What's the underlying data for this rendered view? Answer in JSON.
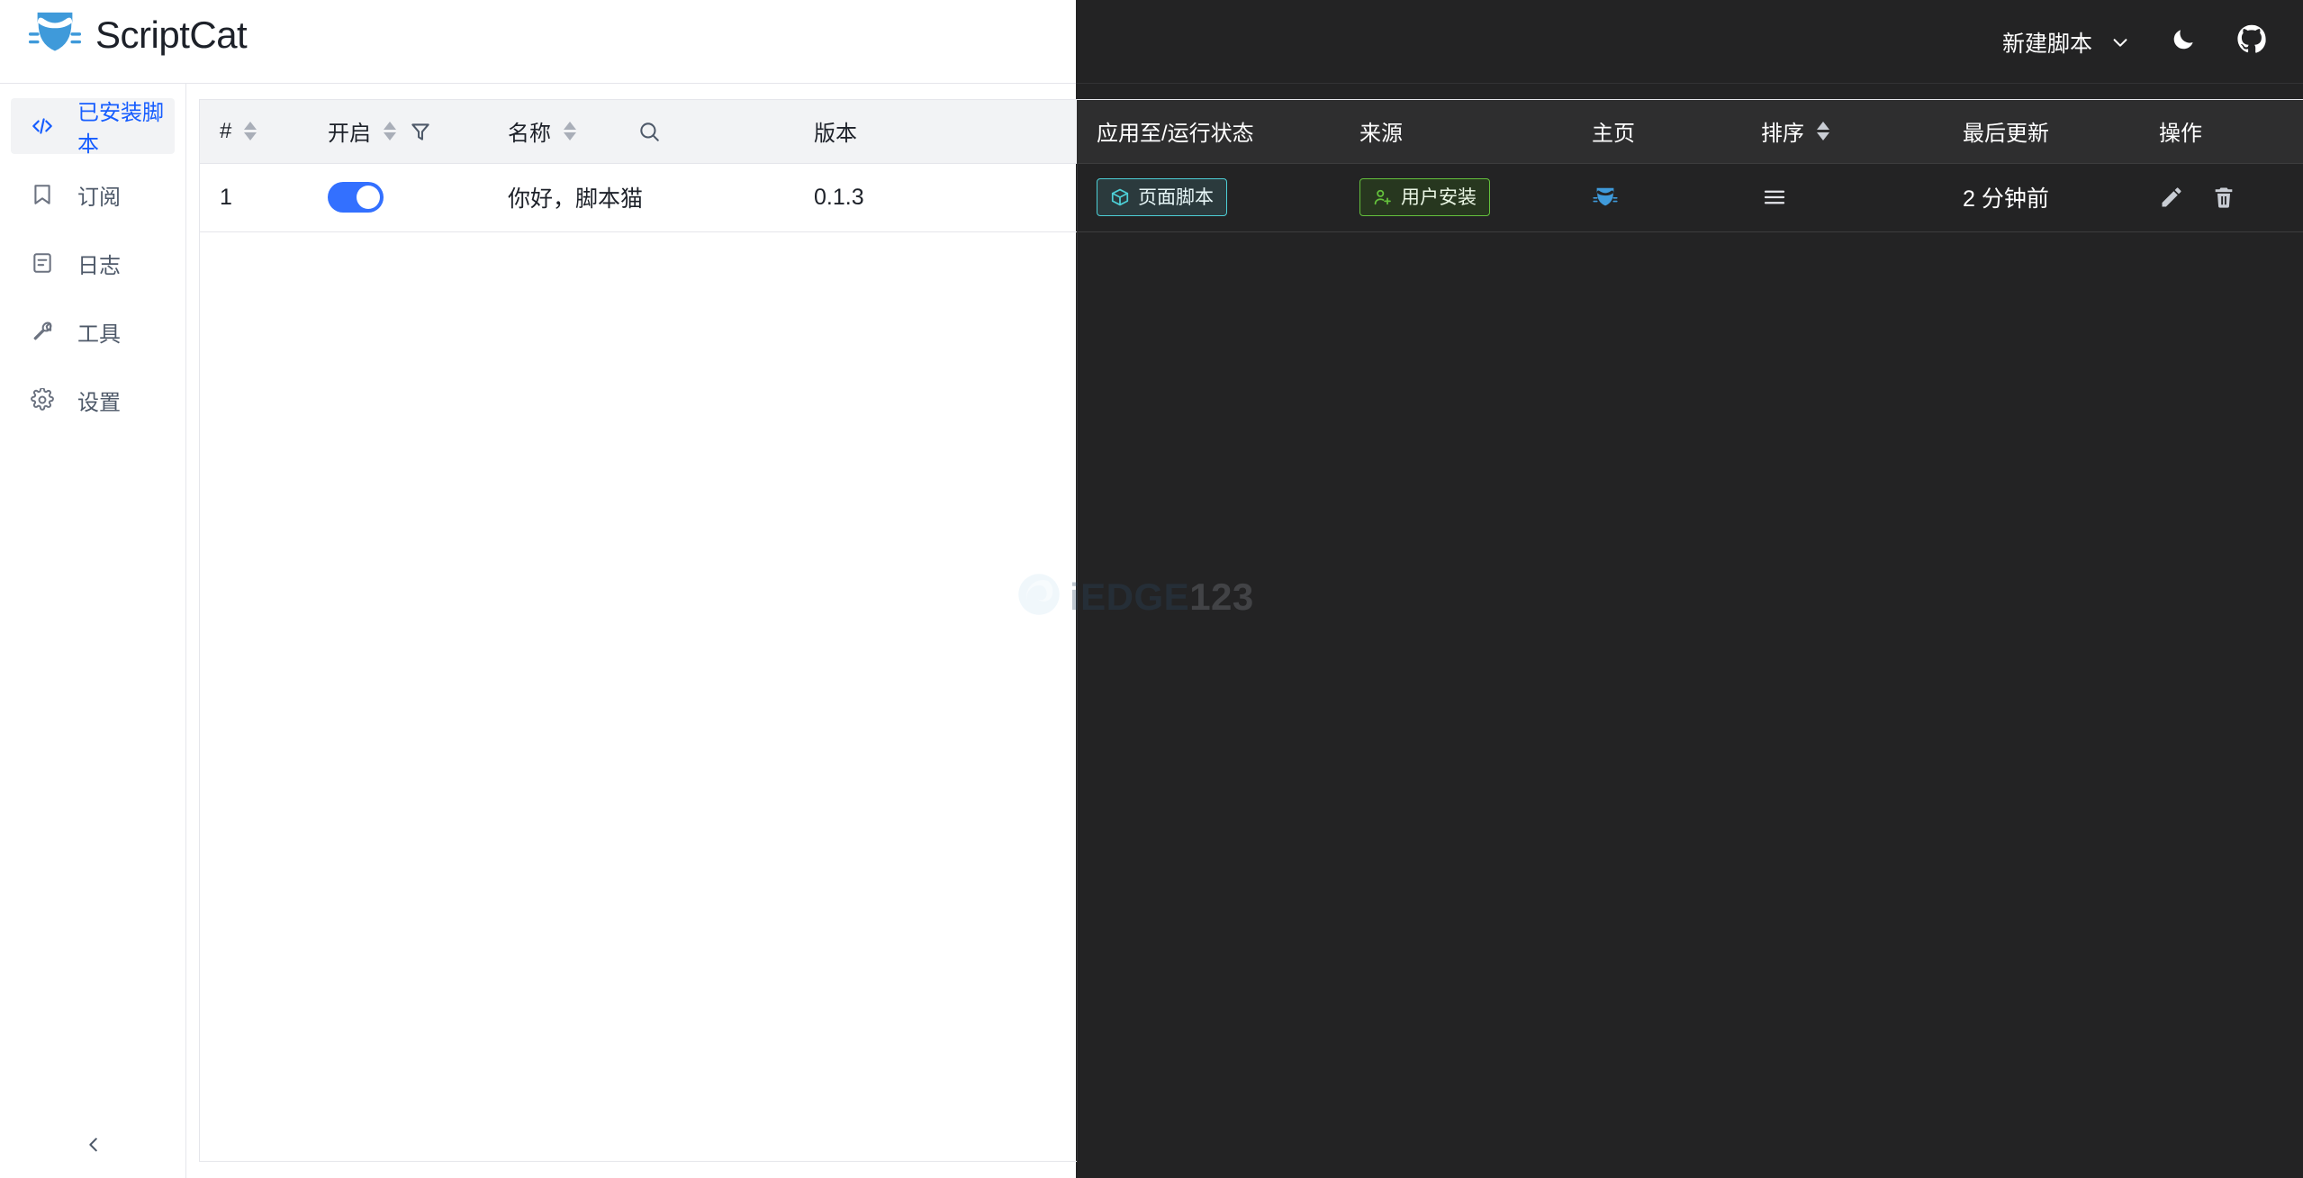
{
  "app": {
    "brand_name": "ScriptCat",
    "logo_icon": "scriptcat-cat-logo"
  },
  "header": {
    "new_script_label": "新建脚本",
    "chevron_icon": "chevron-down-icon",
    "theme_toggle_icon": "moon-icon",
    "github_icon": "github-icon"
  },
  "sidebar": {
    "items": [
      {
        "label": "已安装脚本",
        "icon": "code-brackets-icon",
        "active": true
      },
      {
        "label": "订阅",
        "icon": "bookmark-icon",
        "active": false
      },
      {
        "label": "日志",
        "icon": "document-lines-icon",
        "active": false
      },
      {
        "label": "工具",
        "icon": "wrench-icon",
        "active": false
      },
      {
        "label": "设置",
        "icon": "gear-icon",
        "active": false
      }
    ],
    "collapse_icon": "chevron-left-icon"
  },
  "table": {
    "columns": [
      {
        "key": "index",
        "label": "#",
        "sortable": true,
        "dark": false
      },
      {
        "key": "enable",
        "label": "开启",
        "sortable": true,
        "filter": true,
        "dark": false
      },
      {
        "key": "name",
        "label": "名称",
        "sortable": true,
        "search": true,
        "dark": false
      },
      {
        "key": "version",
        "label": "版本",
        "sortable": false,
        "dark": false
      },
      {
        "key": "applyto",
        "label": "应用至/运行状态",
        "sortable": false,
        "dark": true
      },
      {
        "key": "source",
        "label": "来源",
        "sortable": false,
        "dark": true
      },
      {
        "key": "home",
        "label": "主页",
        "sortable": false,
        "dark": true
      },
      {
        "key": "order",
        "label": "排序",
        "sortable": true,
        "dark": true
      },
      {
        "key": "updated",
        "label": "最后更新",
        "sortable": false,
        "dark": true
      },
      {
        "key": "action",
        "label": "操作",
        "sortable": false,
        "dark": true
      }
    ],
    "rows": [
      {
        "index": "1",
        "enabled": true,
        "name": "你好，脚本猫",
        "version": "0.1.3",
        "applyto_badge": {
          "text": "页面脚本",
          "icon": "cube-icon",
          "color": "#4dcfd6"
        },
        "source_badge": {
          "text": "用户安装",
          "icon": "user-add-icon",
          "color": "#64c13c"
        },
        "home_icon": "scriptcat-cat-icon",
        "order_icon": "drag-handle-icon",
        "updated": "2 分钟前",
        "actions": [
          {
            "icon": "pencil-icon",
            "name": "edit"
          },
          {
            "icon": "trash-icon",
            "name": "delete"
          }
        ]
      }
    ]
  },
  "watermark": {
    "text_a": "iEDGE",
    "text_b": "123",
    "icon": "swirl-logo-icon"
  },
  "colors": {
    "accent_blue": "#165dff",
    "switch_on": "#3370ff",
    "dark_bg": "#232324",
    "dark_header": "#2e2e2f",
    "light_header": "#f2f3f5",
    "badge_cyan": "#4dcfd6",
    "badge_green": "#64c13c"
  }
}
